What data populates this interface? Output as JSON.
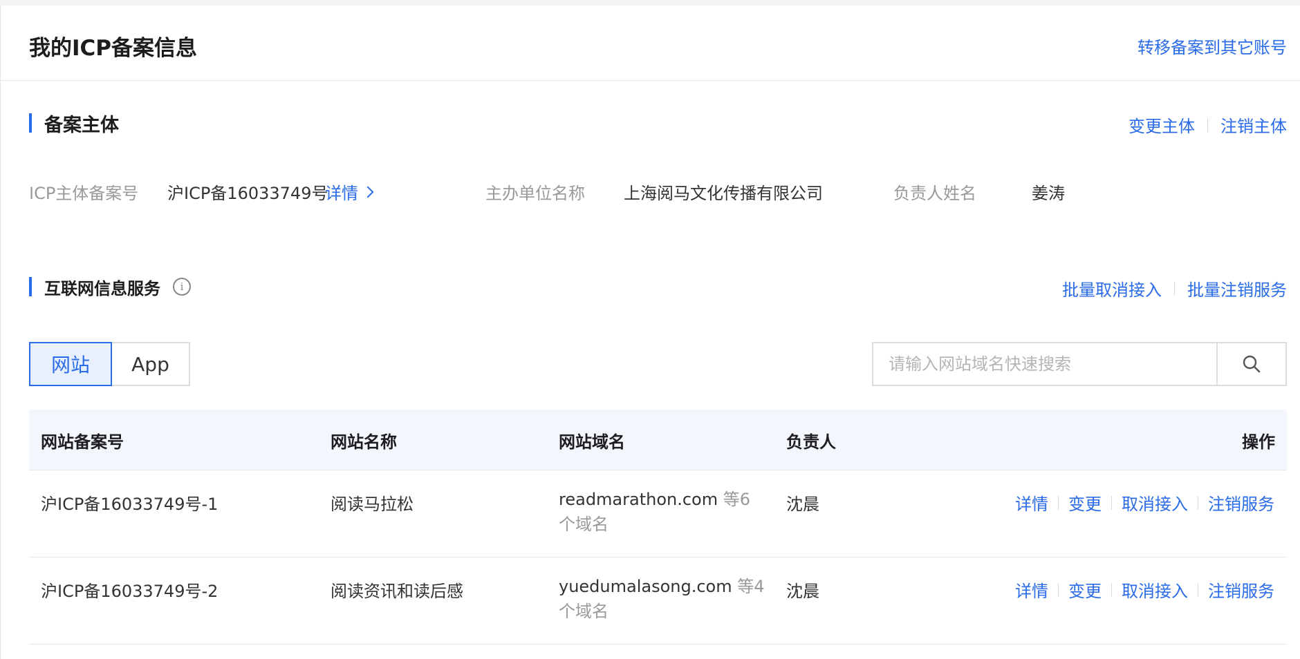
{
  "header": {
    "title": "我的ICP备案信息",
    "transfer_link": "转移备案到其它账号"
  },
  "subject_section": {
    "title": "备案主体",
    "actions": [
      "变更主体",
      "注销主体"
    ],
    "fields": {
      "icp_label": "ICP主体备案号",
      "icp_value": "沪ICP备16033749号",
      "detail_link": "详情",
      "org_label": "主办单位名称",
      "org_value": "上海阅马文化传播有限公司",
      "owner_label": "负责人姓名",
      "owner_value": "姜涛"
    }
  },
  "service_section": {
    "title": "互联网信息服务",
    "info_icon": "info-icon",
    "actions": [
      "批量取消接入",
      "批量注销服务"
    ],
    "tabs": [
      {
        "label": "网站",
        "active": true
      },
      {
        "label": "App",
        "active": false
      }
    ],
    "search": {
      "placeholder": "请输入网站域名快速搜索",
      "icon": "search-icon"
    },
    "table": {
      "columns": [
        "网站备案号",
        "网站名称",
        "网站域名",
        "负责人",
        "操作"
      ],
      "rows": [
        {
          "record_no": "沪ICP备16033749号-1",
          "site_name": "阅读马拉松",
          "domain": "readmarathon.com",
          "domain_more": "等6个域名",
          "owner": "沈晨",
          "actions": [
            "详情",
            "变更",
            "取消接入",
            "注销服务"
          ]
        },
        {
          "record_no": "沪ICP备16033749号-2",
          "site_name": "阅读资讯和读后感",
          "domain": "yuedumalasong.com",
          "domain_more": "等4个域名",
          "owner": "沈晨",
          "actions": [
            "详情",
            "变更",
            "取消接入",
            "注销服务"
          ]
        }
      ]
    }
  },
  "colors": {
    "accent": "#2a6be8",
    "header_bg": "#f3f7fd",
    "tab_active_bg": "#e8f0fe"
  }
}
